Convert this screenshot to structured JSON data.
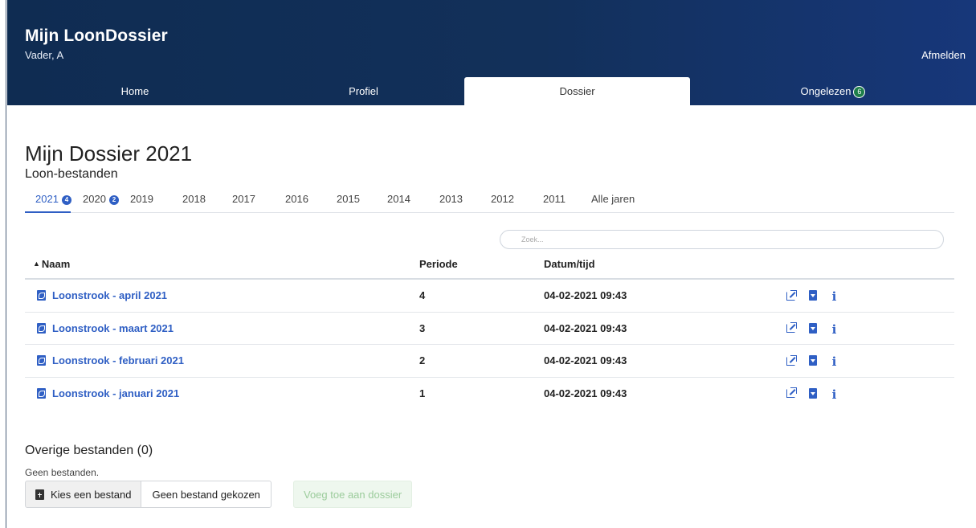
{
  "app": {
    "title": "Mijn LoonDossier",
    "user": "Vader, A",
    "logout_label": "Afmelden"
  },
  "nav": {
    "items": [
      {
        "label": "Home",
        "active": false
      },
      {
        "label": "Profiel",
        "active": false
      },
      {
        "label": "Dossier",
        "active": true
      },
      {
        "label": "Ongelezen",
        "active": false,
        "badge": "6"
      }
    ]
  },
  "page": {
    "title": "Mijn Dossier 2021",
    "section_title": "Loon-bestanden"
  },
  "years": {
    "tabs": [
      {
        "label": "2021",
        "badge": "4",
        "active": true
      },
      {
        "label": "2020",
        "badge": "2"
      },
      {
        "label": "2019"
      },
      {
        "label": "2018"
      },
      {
        "label": "2017"
      },
      {
        "label": "2016"
      },
      {
        "label": "2015"
      },
      {
        "label": "2014"
      },
      {
        "label": "2013"
      },
      {
        "label": "2012"
      },
      {
        "label": "2011"
      },
      {
        "label": "Alle jaren"
      }
    ]
  },
  "search": {
    "placeholder": "Zoek..."
  },
  "table": {
    "headers": {
      "name": "Naam",
      "period": "Periode",
      "datetime": "Datum/tijd"
    },
    "rows": [
      {
        "name": "Loonstrook - april 2021",
        "period": "4",
        "datetime": "04-02-2021 09:43"
      },
      {
        "name": "Loonstrook - maart 2021",
        "period": "3",
        "datetime": "04-02-2021 09:43"
      },
      {
        "name": "Loonstrook - februari 2021",
        "period": "2",
        "datetime": "04-02-2021 09:43"
      },
      {
        "name": "Loonstrook - januari 2021",
        "period": "1",
        "datetime": "04-02-2021 09:43"
      }
    ]
  },
  "other": {
    "title": "Overige bestanden (0)",
    "empty": "Geen bestanden.",
    "choose_label": "Kies een bestand",
    "file_status": "Geen bestand gekozen",
    "add_label": "Voeg toe aan dossier"
  },
  "colors": {
    "header": "#12305a",
    "accent": "#2f5fc4",
    "badge_green": "#1e7e4a"
  }
}
